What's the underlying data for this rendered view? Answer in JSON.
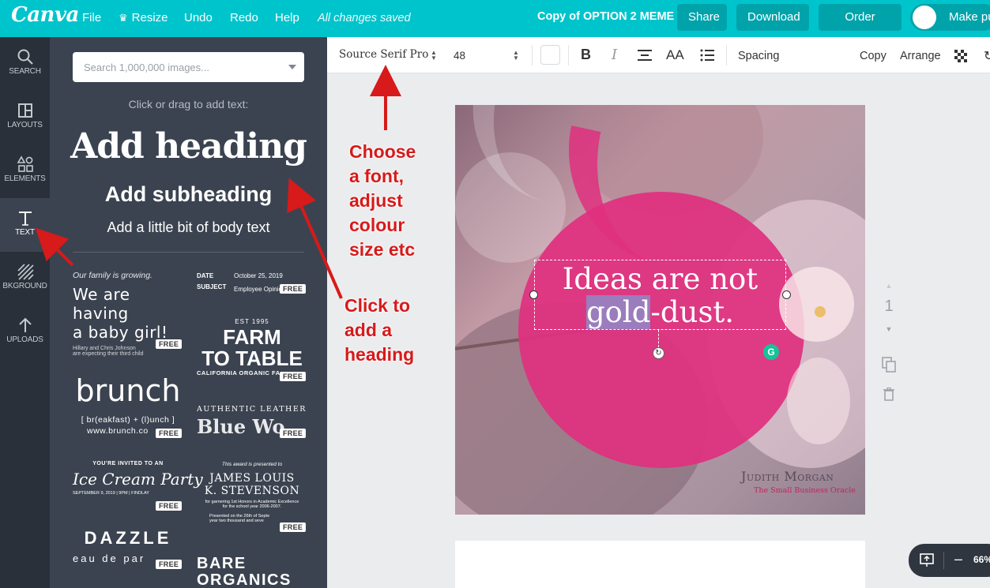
{
  "topbar": {
    "logo": "Canva",
    "menu": [
      "File",
      "Resize",
      "Undo",
      "Redo",
      "Help"
    ],
    "saved_status": "All changes saved",
    "design_title": "Copy of OPTION 2 MEME",
    "share": "Share",
    "download": "Download",
    "order_prints": "Order prints",
    "make_public": "Make pu"
  },
  "rail": [
    {
      "label": "SEARCH",
      "icon": "search-icon"
    },
    {
      "label": "LAYOUTS",
      "icon": "layouts-icon"
    },
    {
      "label": "ELEMENTS",
      "icon": "elements-icon"
    },
    {
      "label": "TEXT",
      "icon": "text-icon"
    },
    {
      "label": "BKGROUND",
      "icon": "background-icon"
    },
    {
      "label": "UPLOADS",
      "icon": "uploads-icon"
    }
  ],
  "panel": {
    "search_placeholder": "Search 1,000,000 images...",
    "hint": "Click or drag to add text:",
    "add_heading": "Add heading",
    "add_subheading": "Add subheading",
    "add_body": "Add a little bit of body text",
    "free_badge": "FREE",
    "templates": {
      "baby": {
        "line1": "Our family is growing.",
        "line2": "We are having",
        "line3": "a baby girl!",
        "line4": "Hillary and Chris Johnson",
        "line5": "are expecting their third child"
      },
      "memo": {
        "date_label": "DATE",
        "date_value": "October 25, 2019",
        "subject_label": "SUBJECT",
        "subject_value": "Employee Opinio"
      },
      "farm": {
        "est": "EST 1995",
        "line1": "FARM",
        "line2": "TO TABLE",
        "sub": "CALIFORNIA ORGANIC FA"
      },
      "brunch": {
        "word": "brunch",
        "formula": "[ br(eakfast) + (l)unch ]",
        "url": "www.brunch.co"
      },
      "leather": {
        "small": "AUTHENTIC LEATHER",
        "big": "Blue Wo"
      },
      "icecream": {
        "small": "YOU'RE INVITED TO AN",
        "big": "Ice Cream Party",
        "date": "SEPTEMBER 9, 2019 | 9PM | FINDLAY"
      },
      "award": {
        "small": "This award is presented to",
        "line1": "JAMES LOUIS",
        "line2": "K. STEVENSON",
        "desc1": "for garnering 1st Honors in Academic Excellence",
        "desc2": "for the school year 2006-2007.",
        "desc3": "Presented on the 26th of Septe",
        "desc4": "year two thousand and seve"
      },
      "dazzle": {
        "big": "DAZZLE",
        "small": "eau de par"
      },
      "bare": {
        "line1": "BARE",
        "line2": "ORGANICS"
      }
    }
  },
  "toolbar": {
    "font": "Source Serif Pro",
    "size": "48",
    "bold": "B",
    "italic": "I",
    "case": "AA",
    "spacing": "Spacing",
    "copy": "Copy",
    "arrange": "Arrange"
  },
  "design": {
    "quote_line1": "Ideas are not",
    "quote_highlight": "gold",
    "quote_rest": "-dust.",
    "author_name": "Judith Morgan",
    "author_sub": "The Small Business Oracle",
    "accent": "#e0307f"
  },
  "page_tools": {
    "page_number": "1"
  },
  "zoom": {
    "value": "66%"
  },
  "annotations": {
    "font_tip": [
      "Choose",
      "a font,",
      "adjust",
      "colour",
      "size etc"
    ],
    "heading_tip": [
      "Click to",
      "add a",
      "heading"
    ]
  },
  "colors": {
    "brand": "#00c4cc",
    "rail": "#293039",
    "panel": "#3b4350",
    "annotation": "#d71a1a"
  }
}
